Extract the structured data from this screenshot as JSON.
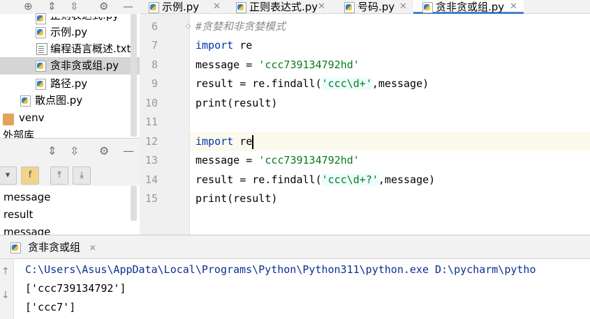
{
  "project_tree": {
    "items": [
      {
        "label": "正则表达式.py",
        "type": "python"
      },
      {
        "label": "示例.py",
        "type": "python"
      },
      {
        "label": "编程语言概述.txt",
        "type": "text"
      },
      {
        "label": "贪非贪或组.py",
        "type": "python",
        "selected": true
      },
      {
        "label": "路径.py",
        "type": "python"
      },
      {
        "label": "散点图.py",
        "type": "python"
      },
      {
        "label": "venv",
        "type": "folder"
      },
      {
        "label": "外部库",
        "type": "library"
      }
    ]
  },
  "structure": {
    "items": [
      "message",
      "result",
      "message"
    ]
  },
  "editor_tabs": [
    {
      "label": "示例.py",
      "active": false
    },
    {
      "label": "正则表达式.py",
      "active": false
    },
    {
      "label": "号码.py",
      "active": false
    },
    {
      "label": "贪非贪或组.py",
      "active": true
    }
  ],
  "code": {
    "line_numbers": [
      "6",
      "7",
      "8",
      "9",
      "10",
      "11",
      "12",
      "13",
      "14",
      "15"
    ],
    "lines": {
      "l6_comment": "#贪婪和非贪婪模式",
      "l7_kw": "import",
      "l7_mod": "re",
      "l8_var": "message = ",
      "l8_str": "'ccc739134792hd'",
      "l9_head": "result = re.findall(",
      "l9_str": "'ccc\\d+'",
      "l9_tail": ",message)",
      "l10_fn": "print",
      "l10_arg": "(result)",
      "l12_kw": "import",
      "l12_mod": "re",
      "l13_var": "message = ",
      "l13_str": "'ccc739134792hd'",
      "l14_head": "result = re.findall(",
      "l14_str": "'ccc\\d+?'",
      "l14_tail": ",message)",
      "l15_fn": "print",
      "l15_arg": "(result)"
    }
  },
  "run_panel": {
    "tab_label": "贪非贪或组",
    "command": "C:\\Users\\Asus\\AppData\\Local\\Programs\\Python\\Python311\\python.exe D:\\pycharm\\pytho",
    "output": [
      "['ccc739134792']",
      "['ccc7']"
    ]
  },
  "colors": {
    "accent_tab": "#4083c9",
    "keyword": "#0033b3",
    "string": "#067d17",
    "console_command": "#0b2f93"
  }
}
